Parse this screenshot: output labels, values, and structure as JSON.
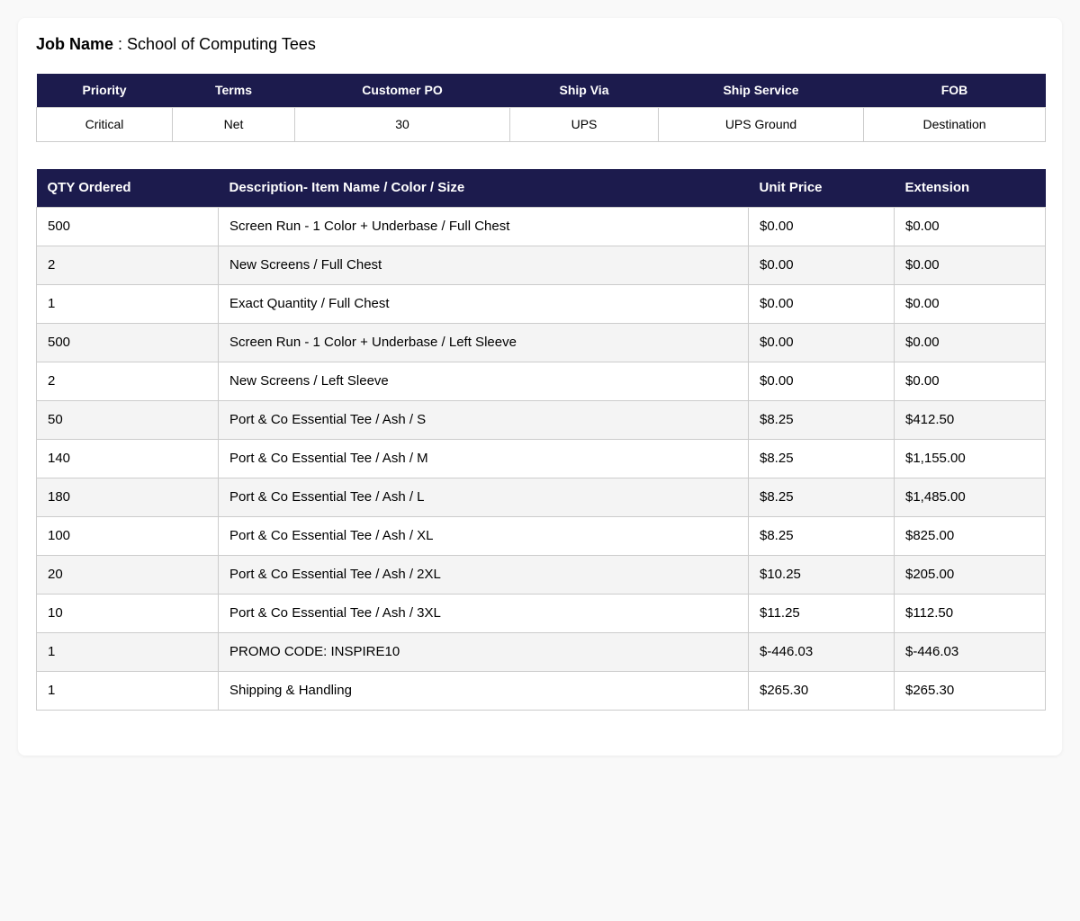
{
  "job": {
    "label": "Job Name",
    "separator": " : ",
    "name": "School of Computing Tees"
  },
  "info_table": {
    "headers": [
      "Priority",
      "Terms",
      "Customer PO",
      "Ship Via",
      "Ship Service",
      "FOB"
    ],
    "values": [
      "Critical",
      "Net",
      "30",
      "UPS",
      "UPS Ground",
      "Destination"
    ]
  },
  "items_table": {
    "headers": [
      "QTY Ordered",
      "Description- Item Name / Color / Size",
      "Unit Price",
      "Extension"
    ],
    "rows": [
      [
        "500",
        "Screen Run - 1 Color + Underbase / Full Chest",
        "$0.00",
        "$0.00"
      ],
      [
        "2",
        "New Screens / Full Chest",
        "$0.00",
        "$0.00"
      ],
      [
        "1",
        "Exact Quantity / Full Chest",
        "$0.00",
        "$0.00"
      ],
      [
        "500",
        "Screen Run - 1 Color + Underbase / Left Sleeve",
        "$0.00",
        "$0.00"
      ],
      [
        "2",
        "New Screens / Left Sleeve",
        "$0.00",
        "$0.00"
      ],
      [
        "50",
        "Port & Co Essential Tee / Ash / S",
        "$8.25",
        "$412.50"
      ],
      [
        "140",
        "Port & Co Essential Tee / Ash / M",
        "$8.25",
        "$1,155.00"
      ],
      [
        "180",
        "Port & Co Essential Tee / Ash / L",
        "$8.25",
        "$1,485.00"
      ],
      [
        "100",
        "Port & Co Essential Tee / Ash / XL",
        "$8.25",
        "$825.00"
      ],
      [
        "20",
        "Port & Co Essential Tee / Ash / 2XL",
        "$10.25",
        "$205.00"
      ],
      [
        "10",
        "Port & Co Essential Tee / Ash / 3XL",
        "$11.25",
        "$112.50"
      ],
      [
        "1",
        "PROMO CODE: INSPIRE10",
        "$-446.03",
        "$-446.03"
      ],
      [
        "1",
        "Shipping & Handling",
        "$265.30",
        "$265.30"
      ]
    ]
  },
  "colors": {
    "header_bg": "#1c1b4d",
    "page_bg": "#f9f9f9",
    "stripe_bg": "#f4f4f4"
  }
}
